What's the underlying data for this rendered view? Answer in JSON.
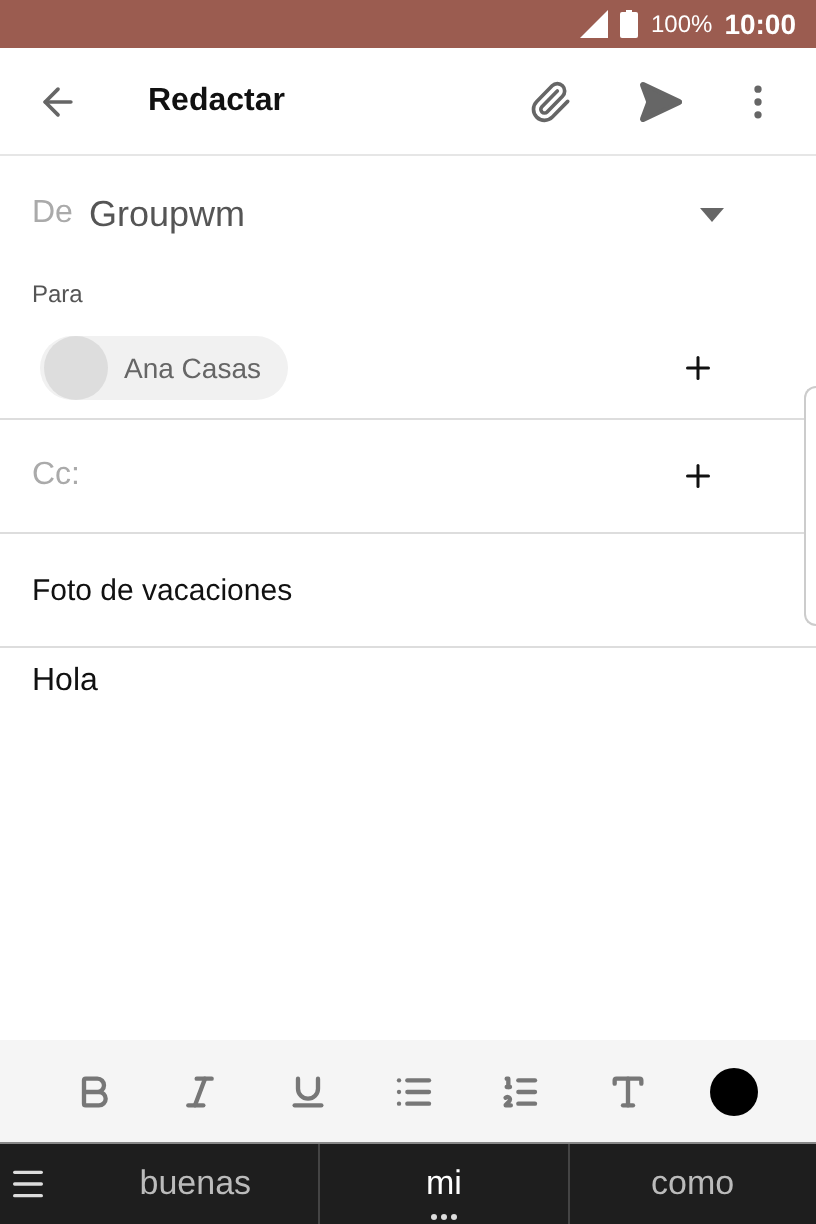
{
  "status_bar": {
    "battery": "100%",
    "time": "10:00"
  },
  "toolbar": {
    "title": "Redactar"
  },
  "from": {
    "label": "De",
    "account": "Groupwm"
  },
  "to": {
    "label": "Para",
    "recipients": [
      {
        "name": "Ana Casas"
      }
    ]
  },
  "cc": {
    "placeholder": "Cc:"
  },
  "subject": {
    "value": "Foto de vacaciones"
  },
  "body": {
    "value": "Hola"
  },
  "format_tools": [
    {
      "kind": "bold"
    },
    {
      "kind": "italic"
    },
    {
      "kind": "underline"
    },
    {
      "kind": "bullets"
    },
    {
      "kind": "numbers"
    },
    {
      "kind": "size"
    },
    {
      "kind": "color"
    }
  ],
  "suggestions": [
    {
      "word": "buenas",
      "selected": false
    },
    {
      "word": "mi",
      "selected": true
    },
    {
      "word": "como",
      "selected": false
    }
  ]
}
